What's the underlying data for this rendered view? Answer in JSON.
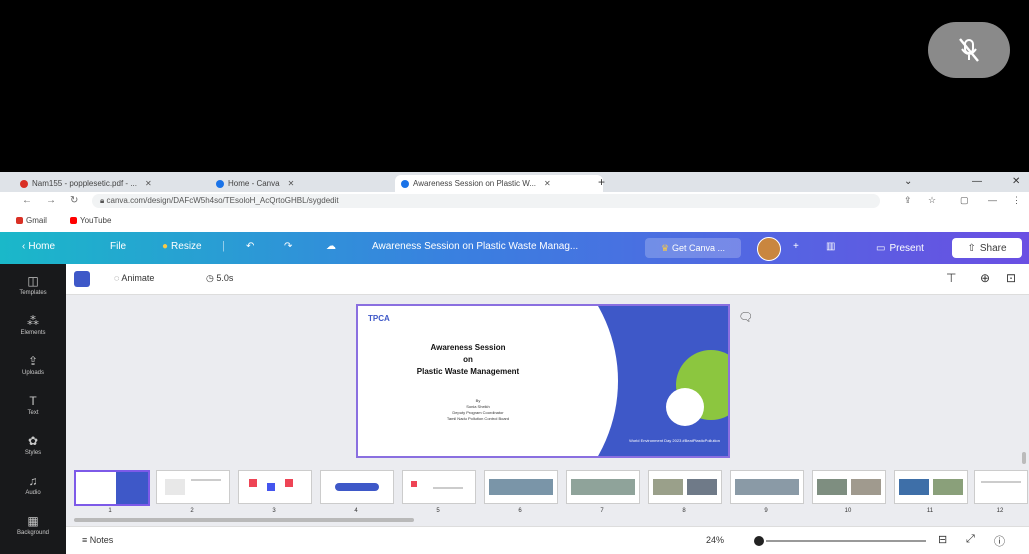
{
  "browser": {
    "tabs": [
      {
        "label": "Nam155 - popplesetic.pdf - ..."
      },
      {
        "label": "Home - Canva"
      },
      {
        "label": "Awareness Session on Plastic W..."
      }
    ],
    "url": "canva.com/design/DAFcW5h4so/TEsoloH_AcQrtoGHBL/sygdedit",
    "bookmarks": [
      {
        "label": "Gmail",
        "color": "#d93025"
      },
      {
        "label": "YouTube",
        "color": "#ff0000"
      }
    ]
  },
  "canva": {
    "home": "Home",
    "file": "File",
    "resize": "Resize",
    "doc_title": "Awareness Session on Plastic Waste Manag...",
    "upgrade": "Get Canva ...",
    "add": "+",
    "present": "Present",
    "share": "Share"
  },
  "side_panel": [
    {
      "icon": "templates-icon",
      "glyph": "◫",
      "label": "Templates"
    },
    {
      "icon": "elements-icon",
      "glyph": "⁂",
      "label": "Elements"
    },
    {
      "icon": "uploads-icon",
      "glyph": "⇪",
      "label": "Uploads"
    },
    {
      "icon": "text-icon",
      "glyph": "T",
      "label": "Text"
    },
    {
      "icon": "styles-icon",
      "glyph": "✿",
      "label": "Styles"
    },
    {
      "icon": "audio-icon",
      "glyph": "♫",
      "label": "Audio"
    },
    {
      "icon": "background-icon",
      "glyph": "▦",
      "label": "Background"
    }
  ],
  "editor_toolbar": {
    "animate": "Animate",
    "duration": "5.0s"
  },
  "slide": {
    "logo": "TPCA",
    "title_line1": "Awareness Session",
    "title_line2": "on",
    "title_line3": "Plastic Waste Management",
    "by_line1": "By",
    "by_line2": "Sonia Sheikh",
    "by_line3": "Deputy Program Coordinator",
    "by_line4": "Tamil Nadu Pollution Control Board",
    "footer": "World Environment Day 2023 #BeatPlasticPollution"
  },
  "thumbnails": [
    "1",
    "2",
    "3",
    "4",
    "5",
    "6",
    "7",
    "8",
    "9",
    "10",
    "11",
    "12"
  ],
  "bottom_bar": {
    "notes": "Notes",
    "zoom": "24%"
  },
  "colors": {
    "brand_gradient_start": "#1ab8c9",
    "brand_gradient_end": "#6a4fe3",
    "slide_blue": "#3e58c8",
    "slide_green": "#8cc63f",
    "selection": "#7d5ae8"
  }
}
